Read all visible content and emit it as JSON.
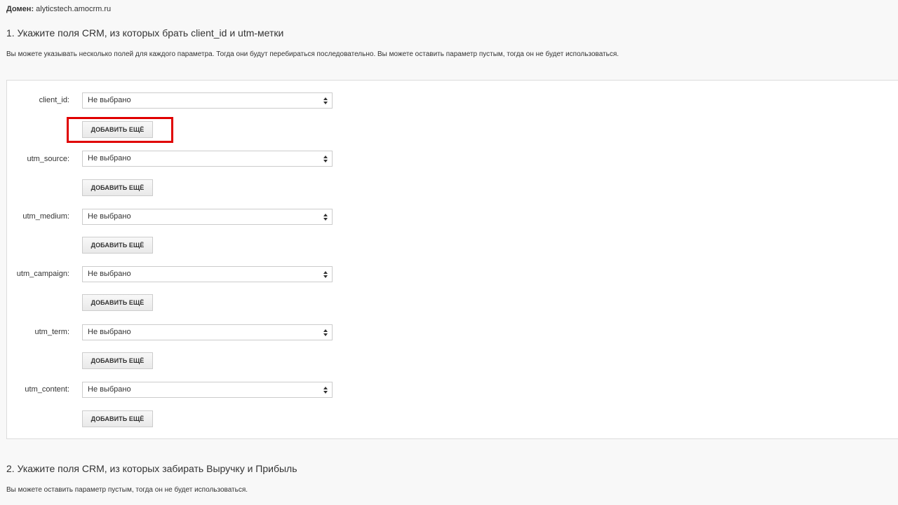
{
  "header": {
    "domain_label": "Домен:",
    "domain_value": "alyticstech.amocrm.ru"
  },
  "section1": {
    "title": "1. Укажите поля CRM, из которых брать client_id и utm-метки",
    "hint": "Вы можете указывать несколько полей для каждого параметра. Тогда они будут перебираться последовательно. Вы можете оставить параметр пустым, тогда он не будет использоваться."
  },
  "fields": [
    {
      "label": "client_id:",
      "select_value": "Не выбрано",
      "add_label": "ДОБАВИТЬ ЕЩЁ"
    },
    {
      "label": "utm_source:",
      "select_value": "Не выбрано",
      "add_label": "ДОБАВИТЬ ЕЩЁ"
    },
    {
      "label": "utm_medium:",
      "select_value": "Не выбрано",
      "add_label": "ДОБАВИТЬ ЕЩЁ"
    },
    {
      "label": "utm_campaign:",
      "select_value": "Не выбрано",
      "add_label": "ДОБАВИТЬ ЕЩЁ"
    },
    {
      "label": "utm_term:",
      "select_value": "Не выбрано",
      "add_label": "ДОБАВИТЬ ЕЩЁ"
    },
    {
      "label": "utm_content:",
      "select_value": "Не выбрано",
      "add_label": "ДОБАВИТЬ ЕЩЁ"
    }
  ],
  "section2": {
    "title": "2. Укажите поля CRM, из которых забирать Выручку и Прибыль",
    "hint": "Вы можете оставить параметр пустым, тогда он не будет использоваться."
  },
  "colors": {
    "highlight": "#e00000",
    "background": "#f8f8f8",
    "panel": "#ffffff"
  },
  "icons": {
    "select_arrows": "up-down-arrows-icon"
  }
}
